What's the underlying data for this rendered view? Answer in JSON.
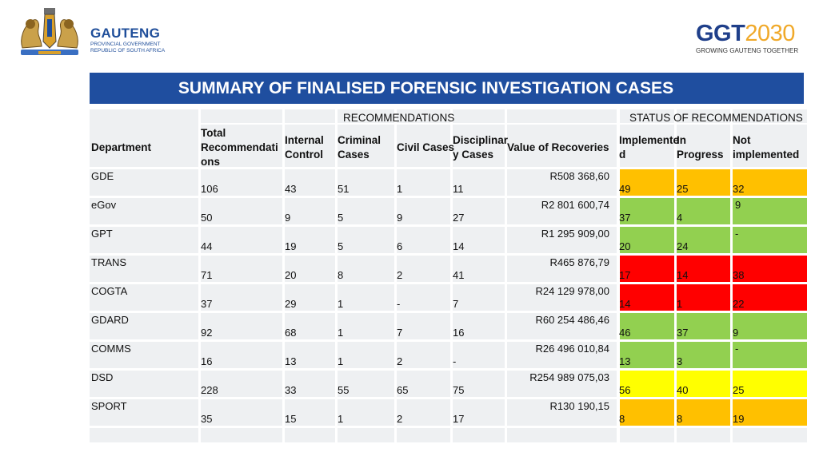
{
  "header": {
    "gauteng_name": "GAUTENG",
    "gauteng_sub1": "PROVINCIAL GOVERNMENT",
    "gauteng_sub2": "REPUBLIC OF SOUTH AFRICA",
    "ggt_part1": "GGT",
    "ggt_part2": "2030",
    "ggt_tagline": "GROWING GAUTENG TOGETHER"
  },
  "title": "SUMMARY OF FINALISED FORENSIC INVESTIGATION CASES",
  "table": {
    "group_recommendations": "RECOMMENDATIONS",
    "group_status": "STATUS OF RECOMMENDATIONS",
    "columns": {
      "department": "Department",
      "total": "Total Recommendati ons",
      "internal": "Internal Control",
      "criminal": "Criminal Cases",
      "civil": "Civil Cases",
      "disciplinary": "Disciplinar y Cases",
      "value": "Value of Recoveries",
      "implemented": "Implemente d",
      "in_progress": "In Progress",
      "not_implemented": "Not implemented"
    },
    "rows": [
      {
        "department": "GDE",
        "total": "106",
        "internal": "43",
        "criminal": "51",
        "civil": "1",
        "disciplinary": "11",
        "value": "R508 368,60",
        "implemented": "49",
        "in_progress": "25",
        "not_implemented": "32",
        "status_color": "#ffc000"
      },
      {
        "department": "eGov",
        "total": "50",
        "internal": "9",
        "criminal": "5",
        "civil": "9",
        "disciplinary": "27",
        "value": "R2 801 600,74",
        "implemented": "37",
        "in_progress": "4",
        "not_implemented": "9",
        "status_color": "#92d050"
      },
      {
        "department": "GPT",
        "total": "44",
        "internal": "19",
        "criminal": "5",
        "civil": "6",
        "disciplinary": "14",
        "value": "R1 295 909,00",
        "implemented": "20",
        "in_progress": "24",
        "not_implemented": "-",
        "status_color": "#92d050"
      },
      {
        "department": "TRANS",
        "total": "71",
        "internal": "20",
        "criminal": "8",
        "civil": "2",
        "disciplinary": "41",
        "value": "R465 876,79",
        "implemented": "17",
        "in_progress": "14",
        "not_implemented": "38",
        "status_color": "#ff0000"
      },
      {
        "department": "COGTA",
        "total": "37",
        "internal": "29",
        "criminal": "1",
        "civil": "-",
        "disciplinary": "7",
        "value": "R24 129 978,00",
        "implemented": "14",
        "in_progress": "1",
        "not_implemented": "22",
        "status_color": "#ff0000"
      },
      {
        "department": "GDARD",
        "total": "92",
        "internal": "68",
        "criminal": "1",
        "civil": "7",
        "disciplinary": "16",
        "value": "R60 254 486,46",
        "implemented": "46",
        "in_progress": "37",
        "not_implemented": "9",
        "status_color": "#92d050"
      },
      {
        "department": "COMMS",
        "total": "16",
        "internal": "13",
        "criminal": "1",
        "civil": "2",
        "disciplinary": "-",
        "value": "R26 496 010,84",
        "implemented": "13",
        "in_progress": "3",
        "not_implemented": "-",
        "status_color": "#92d050"
      },
      {
        "department": "DSD",
        "total": "228",
        "internal": "33",
        "criminal": "55",
        "civil": "65",
        "disciplinary": "75",
        "value": "R254 989 075,03",
        "implemented": "56",
        "in_progress": "40",
        "not_implemented": "25",
        "status_color": "#ffff00"
      },
      {
        "department": "SPORT",
        "total": "35",
        "internal": "15",
        "criminal": "1",
        "civil": "2",
        "disciplinary": "17",
        "value": "R130 190,15",
        "implemented": "8",
        "in_progress": "8",
        "not_implemented": "19",
        "status_color": "#ffc000"
      }
    ]
  }
}
